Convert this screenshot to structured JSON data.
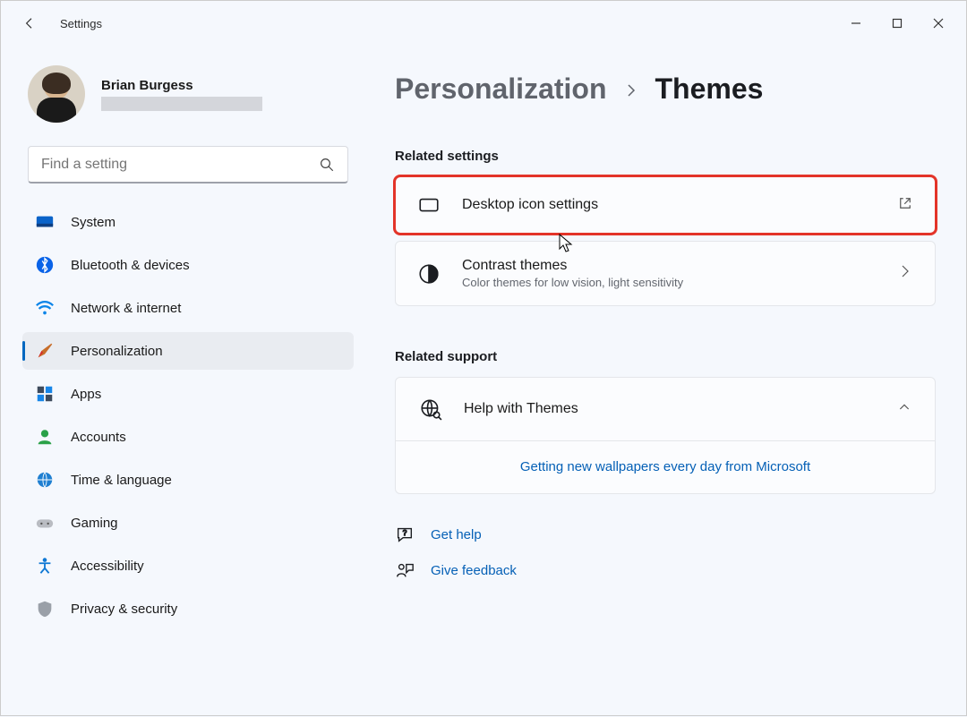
{
  "window": {
    "title": "Settings"
  },
  "user": {
    "name": "Brian Burgess"
  },
  "search": {
    "placeholder": "Find a setting"
  },
  "nav": [
    {
      "id": "system",
      "label": "System",
      "active": false
    },
    {
      "id": "bluetooth",
      "label": "Bluetooth & devices",
      "active": false
    },
    {
      "id": "network",
      "label": "Network & internet",
      "active": false
    },
    {
      "id": "personalization",
      "label": "Personalization",
      "active": true
    },
    {
      "id": "apps",
      "label": "Apps",
      "active": false
    },
    {
      "id": "accounts",
      "label": "Accounts",
      "active": false
    },
    {
      "id": "time",
      "label": "Time & language",
      "active": false
    },
    {
      "id": "gaming",
      "label": "Gaming",
      "active": false
    },
    {
      "id": "accessibility",
      "label": "Accessibility",
      "active": false
    },
    {
      "id": "privacy",
      "label": "Privacy & security",
      "active": false
    }
  ],
  "breadcrumb": {
    "parent": "Personalization",
    "current": "Themes"
  },
  "sections": {
    "related_settings": "Related settings",
    "related_support": "Related support"
  },
  "cards": {
    "desktop_icons": {
      "title": "Desktop icon settings"
    },
    "contrast": {
      "title": "Contrast themes",
      "subtitle": "Color themes for low vision, light sensitivity"
    }
  },
  "support": {
    "help_title": "Help with Themes",
    "link": "Getting new wallpapers every day from Microsoft"
  },
  "help_links": {
    "get_help": "Get help",
    "give_feedback": "Give feedback"
  }
}
